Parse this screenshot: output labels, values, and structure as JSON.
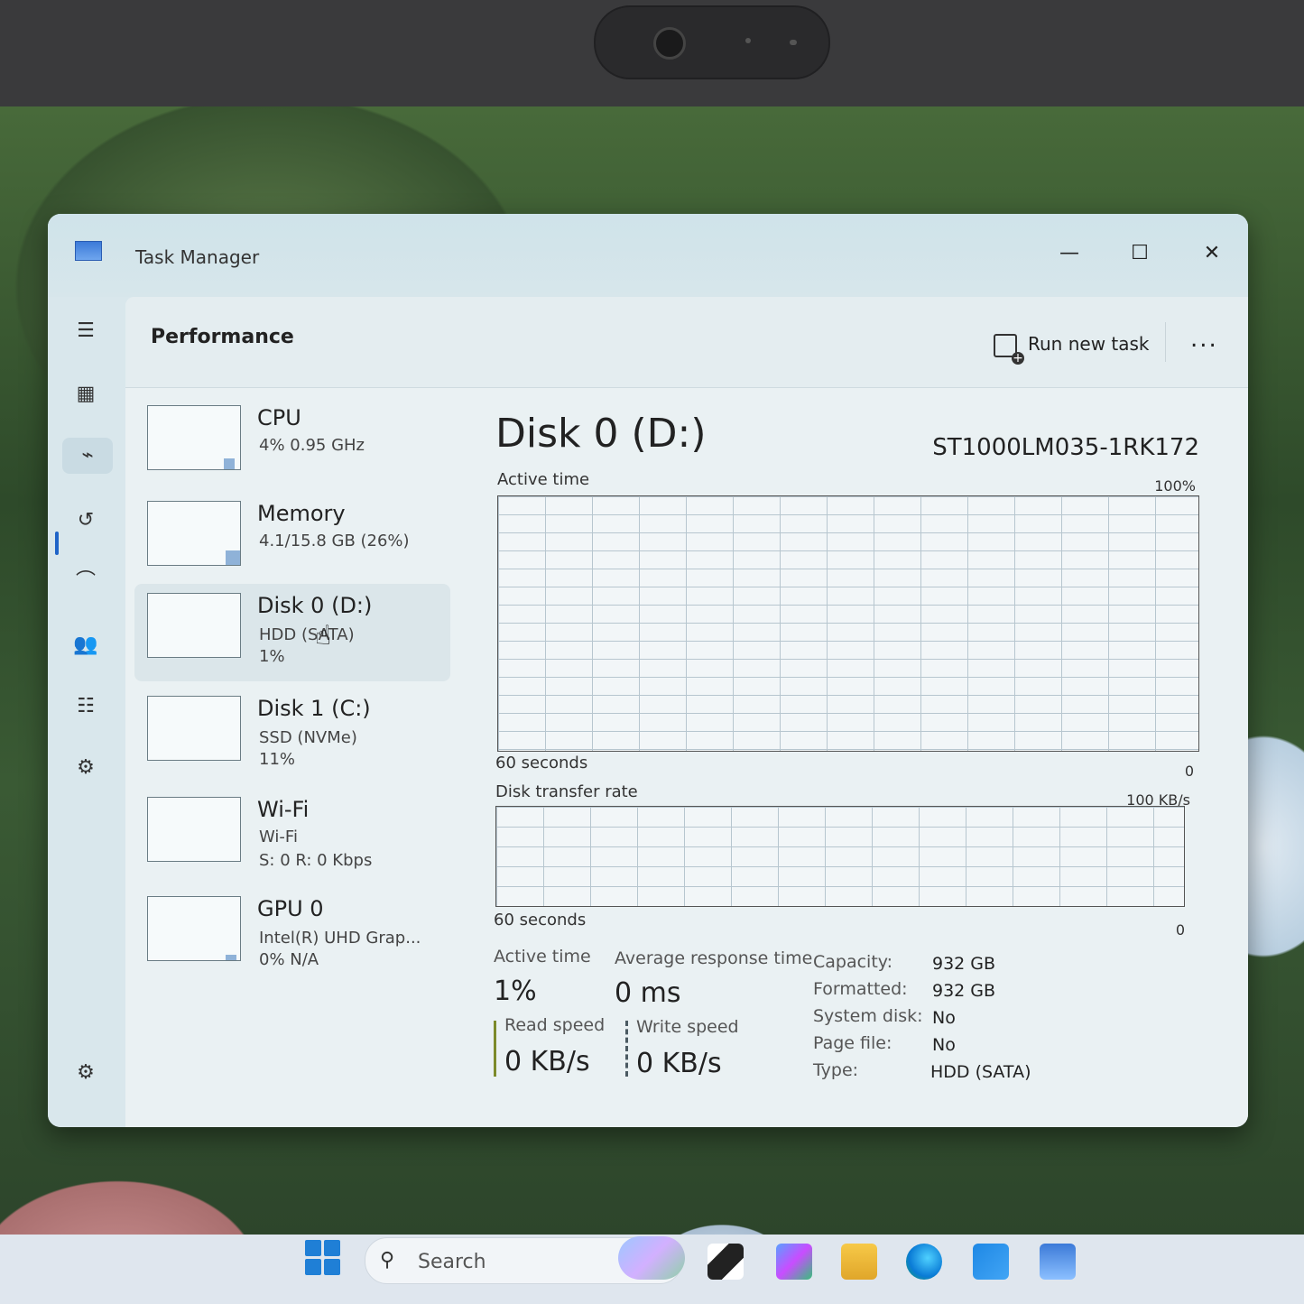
{
  "window": {
    "title": "Task Manager"
  },
  "header": {
    "page_title": "Performance",
    "run_task_label": "Run new task",
    "more_label": "..."
  },
  "nav": {
    "items": [
      {
        "name": "hamburger-icon",
        "glyph": "☰"
      },
      {
        "name": "processes-icon",
        "glyph": "▦"
      },
      {
        "name": "performance-icon",
        "glyph": "⌁"
      },
      {
        "name": "app-history-icon",
        "glyph": "↺"
      },
      {
        "name": "startup-apps-icon",
        "glyph": "⌒"
      },
      {
        "name": "users-icon",
        "glyph": "👥"
      },
      {
        "name": "details-icon",
        "glyph": "☷"
      },
      {
        "name": "services-icon",
        "glyph": "⚙"
      }
    ],
    "settings_glyph": "⚙"
  },
  "perf_list": [
    {
      "name": "CPU",
      "line1": "4%  0.95 GHz",
      "line2": ""
    },
    {
      "name": "Memory",
      "line1": "4.1/15.8 GB (26%)",
      "line2": ""
    },
    {
      "name": "Disk 0 (D:)",
      "line1": "HDD (SATA)",
      "line2": "1%"
    },
    {
      "name": "Disk 1 (C:)",
      "line1": "SSD (NVMe)",
      "line2": "11%"
    },
    {
      "name": "Wi-Fi",
      "line1": "Wi-Fi",
      "line2": "S: 0  R: 0 Kbps"
    },
    {
      "name": "GPU 0",
      "line1": "Intel(R) UHD Grap...",
      "line2": "0%  N/A"
    }
  ],
  "detail": {
    "title": "Disk 0 (D:)",
    "model": "ST1000LM035-1RK172",
    "active_graph": {
      "label": "Active time",
      "max": "100%",
      "time": "60 seconds",
      "min": "0"
    },
    "rate_graph": {
      "label": "Disk transfer rate",
      "max": "100 KB/s",
      "time": "60 seconds",
      "min": "0"
    },
    "stats": {
      "active_time_label": "Active time",
      "active_time_value": "1%",
      "avg_resp_label": "Average response time",
      "avg_resp_value": "0 ms",
      "read_label": "Read speed",
      "read_value": "0 KB/s",
      "write_label": "Write speed",
      "write_value": "0 KB/s"
    },
    "props": [
      {
        "k": "Capacity:",
        "v": "932 GB"
      },
      {
        "k": "Formatted:",
        "v": "932 GB"
      },
      {
        "k": "System disk:",
        "v": "No"
      },
      {
        "k": "Page file:",
        "v": "No"
      },
      {
        "k": "Type:",
        "v": "HDD (SATA)"
      }
    ]
  },
  "taskbar": {
    "search_placeholder": "Search"
  }
}
